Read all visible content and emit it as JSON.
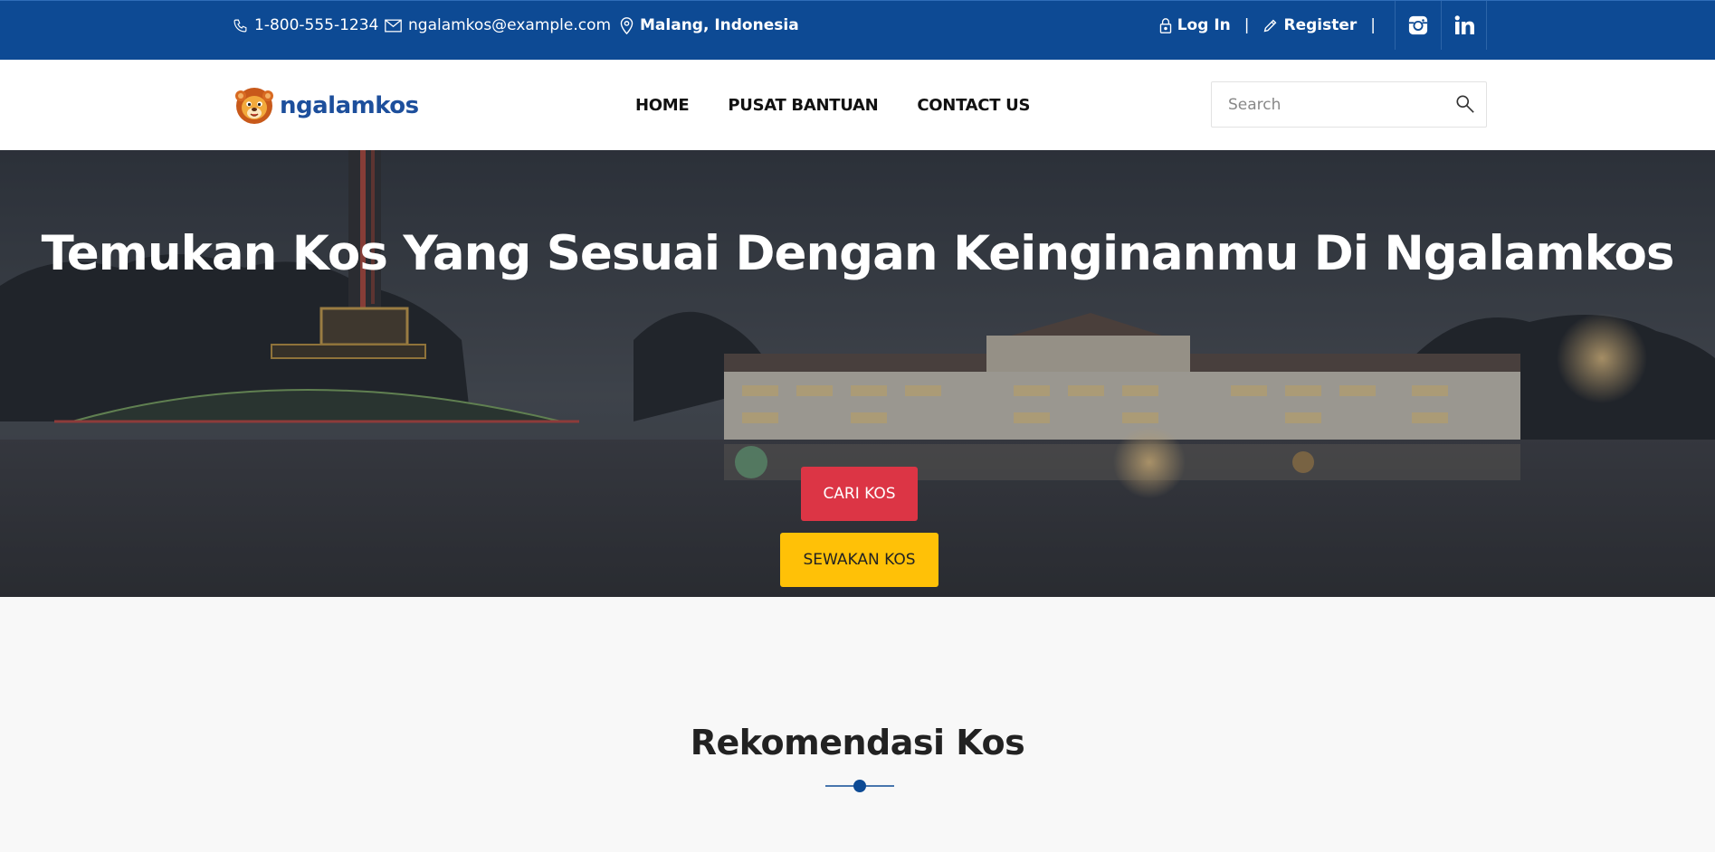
{
  "topbar": {
    "phone": "1-800-555-1234",
    "email": "ngalamkos@example.com",
    "location": "Malang, Indonesia",
    "login_label": "Log In",
    "register_label": "Register",
    "separator": "|",
    "socials": [
      "instagram-icon",
      "linkedin-icon"
    ],
    "bg_color": "#0d4a94"
  },
  "navbar": {
    "logo_text": "ngalamkos",
    "menu": [
      {
        "label": "HOME"
      },
      {
        "label": "PUSAT BANTUAN"
      },
      {
        "label": "CONTACT US"
      }
    ],
    "search_placeholder": "Search"
  },
  "hero": {
    "title": "Temukan Kos Yang Sesuai Dengan Keinginanmu Di Ngalamkos",
    "primary_button": "CARI KOS",
    "secondary_button": "SEWAKAN KOS",
    "primary_color": "#dc3545",
    "secondary_color": "#ffc107"
  },
  "section": {
    "title": "Rekomendasi Kos",
    "accent_color": "#0d4a94"
  }
}
